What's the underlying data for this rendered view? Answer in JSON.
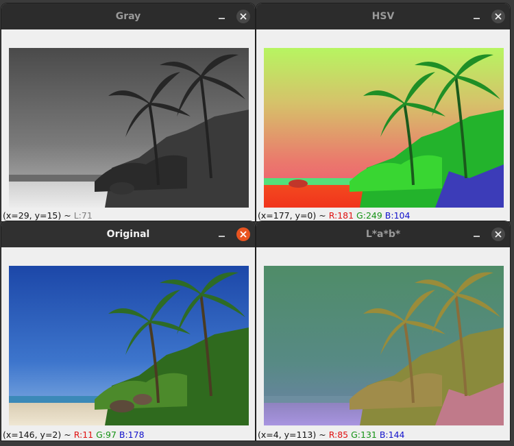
{
  "windows": {
    "gray": {
      "title": "Gray",
      "coords": "(x=29, y=15) ~",
      "l_value": "L:71"
    },
    "hsv": {
      "title": "HSV",
      "coords": "(x=177, y=0) ~",
      "r_value": "R:181",
      "g_value": "G:249",
      "b_value": "B:104"
    },
    "original": {
      "title": "Original",
      "coords": "(x=146, y=2) ~",
      "r_value": "R:11",
      "g_value": "G:97",
      "b_value": "B:178"
    },
    "lab": {
      "title": "L*a*b*",
      "coords": "(x=4, y=113) ~",
      "r_value": "R:85",
      "g_value": "G:131",
      "b_value": "B:144"
    }
  },
  "icons": [
    "minimize-icon",
    "close-icon"
  ],
  "colors": {
    "titlebar": "#2c2c2c",
    "active_close": "#e95420",
    "window_bg": "#efefef",
    "red_text": "#e01010",
    "green_text": "#139213",
    "blue_text": "#1111cc"
  }
}
